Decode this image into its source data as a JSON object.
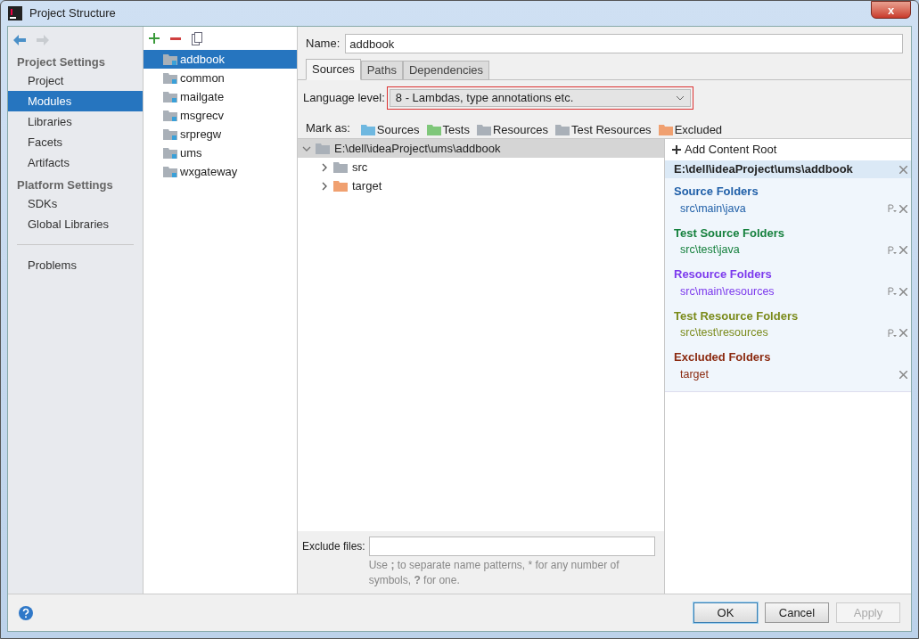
{
  "window": {
    "title": "Project Structure",
    "close": "x"
  },
  "nav": {
    "sections": [
      {
        "heading": "Project Settings",
        "items": [
          {
            "label": "Project",
            "selected": false
          },
          {
            "label": "Modules",
            "selected": true
          },
          {
            "label": "Libraries",
            "selected": false
          },
          {
            "label": "Facets",
            "selected": false
          },
          {
            "label": "Artifacts",
            "selected": false
          }
        ]
      },
      {
        "heading": "Platform Settings",
        "items": [
          {
            "label": "SDKs",
            "selected": false
          },
          {
            "label": "Global Libraries",
            "selected": false
          }
        ]
      }
    ],
    "extra_items": [
      {
        "label": "Problems",
        "selected": false
      }
    ]
  },
  "modules": [
    {
      "name": "addbook",
      "selected": true
    },
    {
      "name": "common",
      "selected": false
    },
    {
      "name": "mailgate",
      "selected": false
    },
    {
      "name": "msgrecv",
      "selected": false
    },
    {
      "name": "srpregw",
      "selected": false
    },
    {
      "name": "ums",
      "selected": false
    },
    {
      "name": "wxgateway",
      "selected": false
    }
  ],
  "name_field": {
    "label": "Name:",
    "value": "addbook"
  },
  "tabs": [
    {
      "label": "Sources",
      "selected": true
    },
    {
      "label": "Paths",
      "selected": false
    },
    {
      "label": "Dependencies",
      "selected": false
    }
  ],
  "language_level": {
    "label": "Language level:",
    "value": "8 - Lambdas, type annotations etc."
  },
  "mark_as": {
    "label": "Mark as:",
    "items": [
      {
        "label": "Sources",
        "color": "#6fb8e0"
      },
      {
        "label": "Tests",
        "color": "#7fc77a"
      },
      {
        "label": "Resources",
        "color": "#a9b0b8"
      },
      {
        "label": "Test Resources",
        "color": "#a9b0b8"
      },
      {
        "label": "Excluded",
        "color": "#f0a070"
      }
    ]
  },
  "tree": [
    {
      "label": "E:\\dell\\ideaProject\\ums\\addbook",
      "expanded": true,
      "selected": true,
      "color": "#a9b0b8",
      "children": [
        {
          "label": "src",
          "expanded": false,
          "selected": false,
          "color": "#a9b0b8"
        },
        {
          "label": "target",
          "expanded": false,
          "selected": false,
          "color": "#f0a070"
        }
      ]
    }
  ],
  "content_root": {
    "add_label": "Add Content Root",
    "path": "E:\\dell\\ideaProject\\ums\\addbook",
    "groups": [
      {
        "title": "Source Folders",
        "color": "#1f5fa8",
        "folders": [
          {
            "path": "src\\main\\java",
            "properties": true
          }
        ]
      },
      {
        "title": "Test Source Folders",
        "color": "#15803d",
        "folders": [
          {
            "path": "src\\test\\java",
            "properties": true
          }
        ]
      },
      {
        "title": "Resource Folders",
        "color": "#7c3aed",
        "folders": [
          {
            "path": "src\\main\\resources",
            "properties": true
          }
        ]
      },
      {
        "title": "Test Resource Folders",
        "color": "#7a8a1a",
        "folders": [
          {
            "path": "src\\test\\resources",
            "properties": true
          }
        ]
      },
      {
        "title": "Excluded Folders",
        "color": "#8b2a10",
        "folders": [
          {
            "path": "target",
            "properties": false
          }
        ]
      }
    ]
  },
  "exclude_files": {
    "label": "Exclude files:",
    "hint": "Use **;** to separate name patterns, * for any number of symbols, **?** for one."
  },
  "buttons": [
    {
      "label": "OK",
      "disabled": false,
      "default": true
    },
    {
      "label": "Cancel",
      "disabled": false,
      "default": false
    },
    {
      "label": "Apply",
      "disabled": true,
      "default": false
    }
  ]
}
